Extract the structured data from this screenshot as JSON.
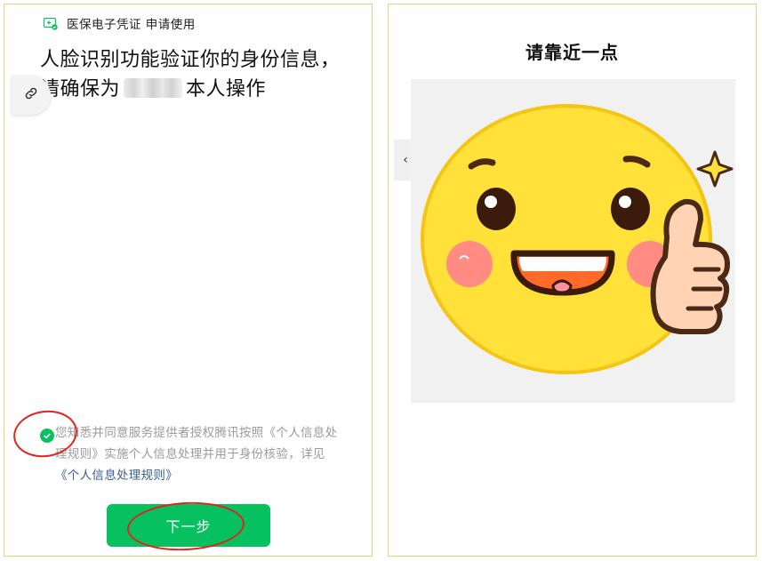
{
  "left_panel": {
    "header_title": "医保电子凭证 申请使用",
    "headline_line1": "人脸识别功能验证你的身份信息，",
    "headline_line2_prefix": "请确保为",
    "headline_line2_suffix": "本人操作",
    "consent_text": "您知悉并同意服务提供者授权腾讯按照《个人信息处理规则》实施个人信息处理并用于身份核验，详见",
    "consent_link": "《个人信息处理规则》",
    "next_button": "下一步"
  },
  "right_panel": {
    "title": "请靠近一点",
    "back_glyph": "‹"
  },
  "icons": [
    "medical-card-icon",
    "link-icon",
    "check-icon",
    "back-icon"
  ],
  "colors": {
    "accent": "#07c160",
    "highlight_circle": "#e0241c",
    "link": "#3b5f8a",
    "frame_border": "#e6cf86"
  }
}
